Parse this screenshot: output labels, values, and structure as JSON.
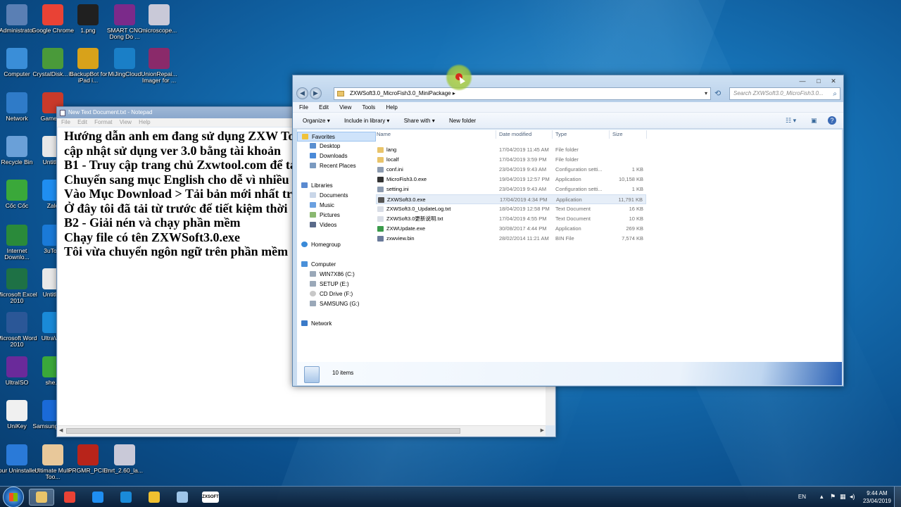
{
  "desktop_icons": [
    {
      "label": "Administrator",
      "icon": "user-folder-icon",
      "color": "#5a7fb4"
    },
    {
      "label": "Google Chrome",
      "icon": "chrome-icon",
      "color": "#e94235"
    },
    {
      "label": "1.png",
      "icon": "image-file-icon",
      "color": "#202020"
    },
    {
      "label": "SMART CNC Dong Do ...",
      "icon": "winrar-icon",
      "color": "#7b2a8a"
    },
    {
      "label": "microscope...",
      "icon": "winrar-icon",
      "color": "#c9c9d8"
    },
    {
      "label": "Computer",
      "icon": "computer-icon",
      "color": "#3a8ed8"
    },
    {
      "label": "CrystalDisk... 5",
      "icon": "crystaldisk-icon",
      "color": "#4a9a3a"
    },
    {
      "label": "iBackupBot for iPad i...",
      "icon": "ibackupbot-icon",
      "color": "#d8a21a"
    },
    {
      "label": "MiJingCloud",
      "icon": "mijingcloud-icon",
      "color": "#1a7fc7"
    },
    {
      "label": "UnionRepai... Imager for ...",
      "icon": "winrar-icon",
      "color": "#8a2a6a"
    },
    {
      "label": "Network",
      "icon": "network-icon",
      "color": "#2f7bc8"
    },
    {
      "label": "GameT...",
      "icon": "gametool-icon",
      "color": "#c93a2a"
    },
    {
      "label": "Recycle Bin",
      "icon": "recycle-bin-icon",
      "color": "#6aa0d8"
    },
    {
      "label": "Untitled",
      "icon": "document-icon",
      "color": "#e8e8e8"
    },
    {
      "label": "Cốc Cốc",
      "icon": "coccoc-icon",
      "color": "#3aa83a"
    },
    {
      "label": "Zalo",
      "icon": "zalo-icon",
      "color": "#1f8ef1"
    },
    {
      "label": "Internet Downlo...",
      "icon": "idm-icon",
      "color": "#2a8a3a"
    },
    {
      "label": "3uTo...",
      "icon": "3utools-icon",
      "color": "#1a7ad8"
    },
    {
      "label": "Microsoft Excel 2010",
      "icon": "excel-icon",
      "color": "#1e7145"
    },
    {
      "label": "Untitled",
      "icon": "document-icon",
      "color": "#e8e8e8"
    },
    {
      "label": "Microsoft Word 2010",
      "icon": "word-icon",
      "color": "#2b5797"
    },
    {
      "label": "UltraVi...",
      "icon": "ultraviewer-icon",
      "color": "#1a8ad8"
    },
    {
      "label": "UltraISO",
      "icon": "ultraiso-icon",
      "color": "#6a2a9a"
    },
    {
      "label": "she...",
      "icon": "shell-icon",
      "color": "#3aa83a"
    },
    {
      "label": "UniKey",
      "icon": "unikey-icon",
      "color": "#f0f0f0"
    },
    {
      "label": "Samsung PR...",
      "icon": "samsung-icon",
      "color": "#1a6ad8"
    },
    {
      "label": "Your Uninstaller!",
      "icon": "uninstaller-icon",
      "color": "#2a7ad8"
    },
    {
      "label": "Ultimate Multi Too...",
      "icon": "umt-icon",
      "color": "#e8c89a"
    },
    {
      "label": "PRGMR_PCIE",
      "icon": "prgmr-icon",
      "color": "#b8241a"
    },
    {
      "label": "mrt_2.60_la...",
      "icon": "winrar-icon",
      "color": "#c9c9d8"
    }
  ],
  "notepad": {
    "title": "New Text Document.txt - Notepad",
    "menu": [
      "File",
      "Edit",
      "Format",
      "View",
      "Help"
    ],
    "lines": [
      "Hướng dẫn anh em đang sử dụng ZXW To",
      "cập nhật sử dụng ver 3.0 bằng tài khoản",
      "B1 - Truy cập trang chủ Zxwtool.com để tả",
      "Chuyển sang mục English cho dễ vì nhiều",
      "Vào Mục Download > Tải bản mới nhất tr",
      "Ở đây tôi đã tải từ trước để tiết kiệm thời",
      "B2 - Giải nén và chạy phần mềm",
      "Chạy file có tên ZXWSoft3.0.exe",
      "Tôi vừa chuyển ngôn ngữ trên phần mềm"
    ]
  },
  "explorer": {
    "path": "ZXWSoft3.0_MicroFish3.0_MiniPackage",
    "search_placeholder": "Search ZXWSoft3.0_MicroFish3.0...",
    "menu": [
      "File",
      "Edit",
      "View",
      "Tools",
      "Help"
    ],
    "toolbar": [
      "Organize",
      "Include in library",
      "Share with",
      "New folder"
    ],
    "nav": {
      "favorites": "Favorites",
      "favorites_items": [
        "Desktop",
        "Downloads",
        "Recent Places"
      ],
      "libraries": "Libraries",
      "libraries_items": [
        "Documents",
        "Music",
        "Pictures",
        "Videos"
      ],
      "homegroup": "Homegroup",
      "computer": "Computer",
      "computer_items": [
        "WIN7X86 (C:)",
        "SETUP (E:)",
        "CD Drive (F:)",
        "SAMSUNG (G:)"
      ],
      "network": "Network"
    },
    "columns": [
      "Name",
      "Date modified",
      "Type",
      "Size"
    ],
    "files": [
      {
        "name": "lang",
        "date": "17/04/2019 11:45 AM",
        "type": "File folder",
        "size": "",
        "icon": "folder-icon",
        "color": "#e9c46a"
      },
      {
        "name": "localf",
        "date": "17/04/2019 3:59 PM",
        "type": "File folder",
        "size": "",
        "icon": "folder-icon",
        "color": "#e9c46a"
      },
      {
        "name": "conf.ini",
        "date": "23/04/2019 9:43 AM",
        "type": "Configuration setti...",
        "size": "1 KB",
        "icon": "settings-file-icon",
        "color": "#8c9bb0"
      },
      {
        "name": "MicroFish3.0.exe",
        "date": "19/04/2019 12:57 PM",
        "type": "Application",
        "size": "10,158 KB",
        "icon": "app-icon",
        "color": "#333333"
      },
      {
        "name": "setting.ini",
        "date": "23/04/2019 9:43 AM",
        "type": "Configuration setti...",
        "size": "1 KB",
        "icon": "settings-file-icon",
        "color": "#8c9bb0"
      },
      {
        "name": "ZXWSoft3.0.exe",
        "date": "17/04/2019 4:34 PM",
        "type": "Application",
        "size": "11,791 KB",
        "icon": "app-icon",
        "color": "#555555"
      },
      {
        "name": "ZXWSoft3.0_UpdateLog.txt",
        "date": "18/04/2019 12:58 PM",
        "type": "Text Document",
        "size": "16 KB",
        "icon": "text-file-icon",
        "color": "#d8dde6"
      },
      {
        "name": "ZXWSoft3.0更新说明.txt",
        "date": "17/04/2019 4:55 PM",
        "type": "Text Document",
        "size": "10 KB",
        "icon": "text-file-icon",
        "color": "#d8dde6"
      },
      {
        "name": "ZXWUpdate.exe",
        "date": "30/08/2017 4:44 PM",
        "type": "Application",
        "size": "269 KB",
        "icon": "update-app-icon",
        "color": "#3a9a4a"
      },
      {
        "name": "zxwview.bin",
        "date": "28/02/2014 11:21 AM",
        "type": "BIN File",
        "size": "7,574 KB",
        "icon": "bin-file-icon",
        "color": "#6a7a9a"
      }
    ],
    "selected_file": "ZXWSoft3.0.exe",
    "status": "10 items"
  },
  "taskbar": {
    "apps": [
      {
        "name": "explorer",
        "icon": "folder-icon",
        "color": "#e9c46a",
        "active": true
      },
      {
        "name": "chrome",
        "icon": "chrome-icon",
        "color": "#e94235",
        "active": false
      },
      {
        "name": "zalo",
        "icon": "zalo-icon",
        "color": "#1f8ef1",
        "active": false
      },
      {
        "name": "ultraviewer",
        "icon": "ultraviewer-icon",
        "color": "#1a8ad8",
        "active": false
      },
      {
        "name": "paint",
        "icon": "paint-icon",
        "color": "#f0c030",
        "active": false
      },
      {
        "name": "notepad",
        "icon": "notepad-icon",
        "color": "#9ec5e8",
        "active": false
      },
      {
        "name": "zxwsoft",
        "icon": "zxwsoft-icon",
        "color": "#ffffff",
        "label": "ZXSOFT",
        "active": false
      }
    ],
    "language": "EN",
    "time": "9:44 AM",
    "date": "23/04/2019"
  }
}
